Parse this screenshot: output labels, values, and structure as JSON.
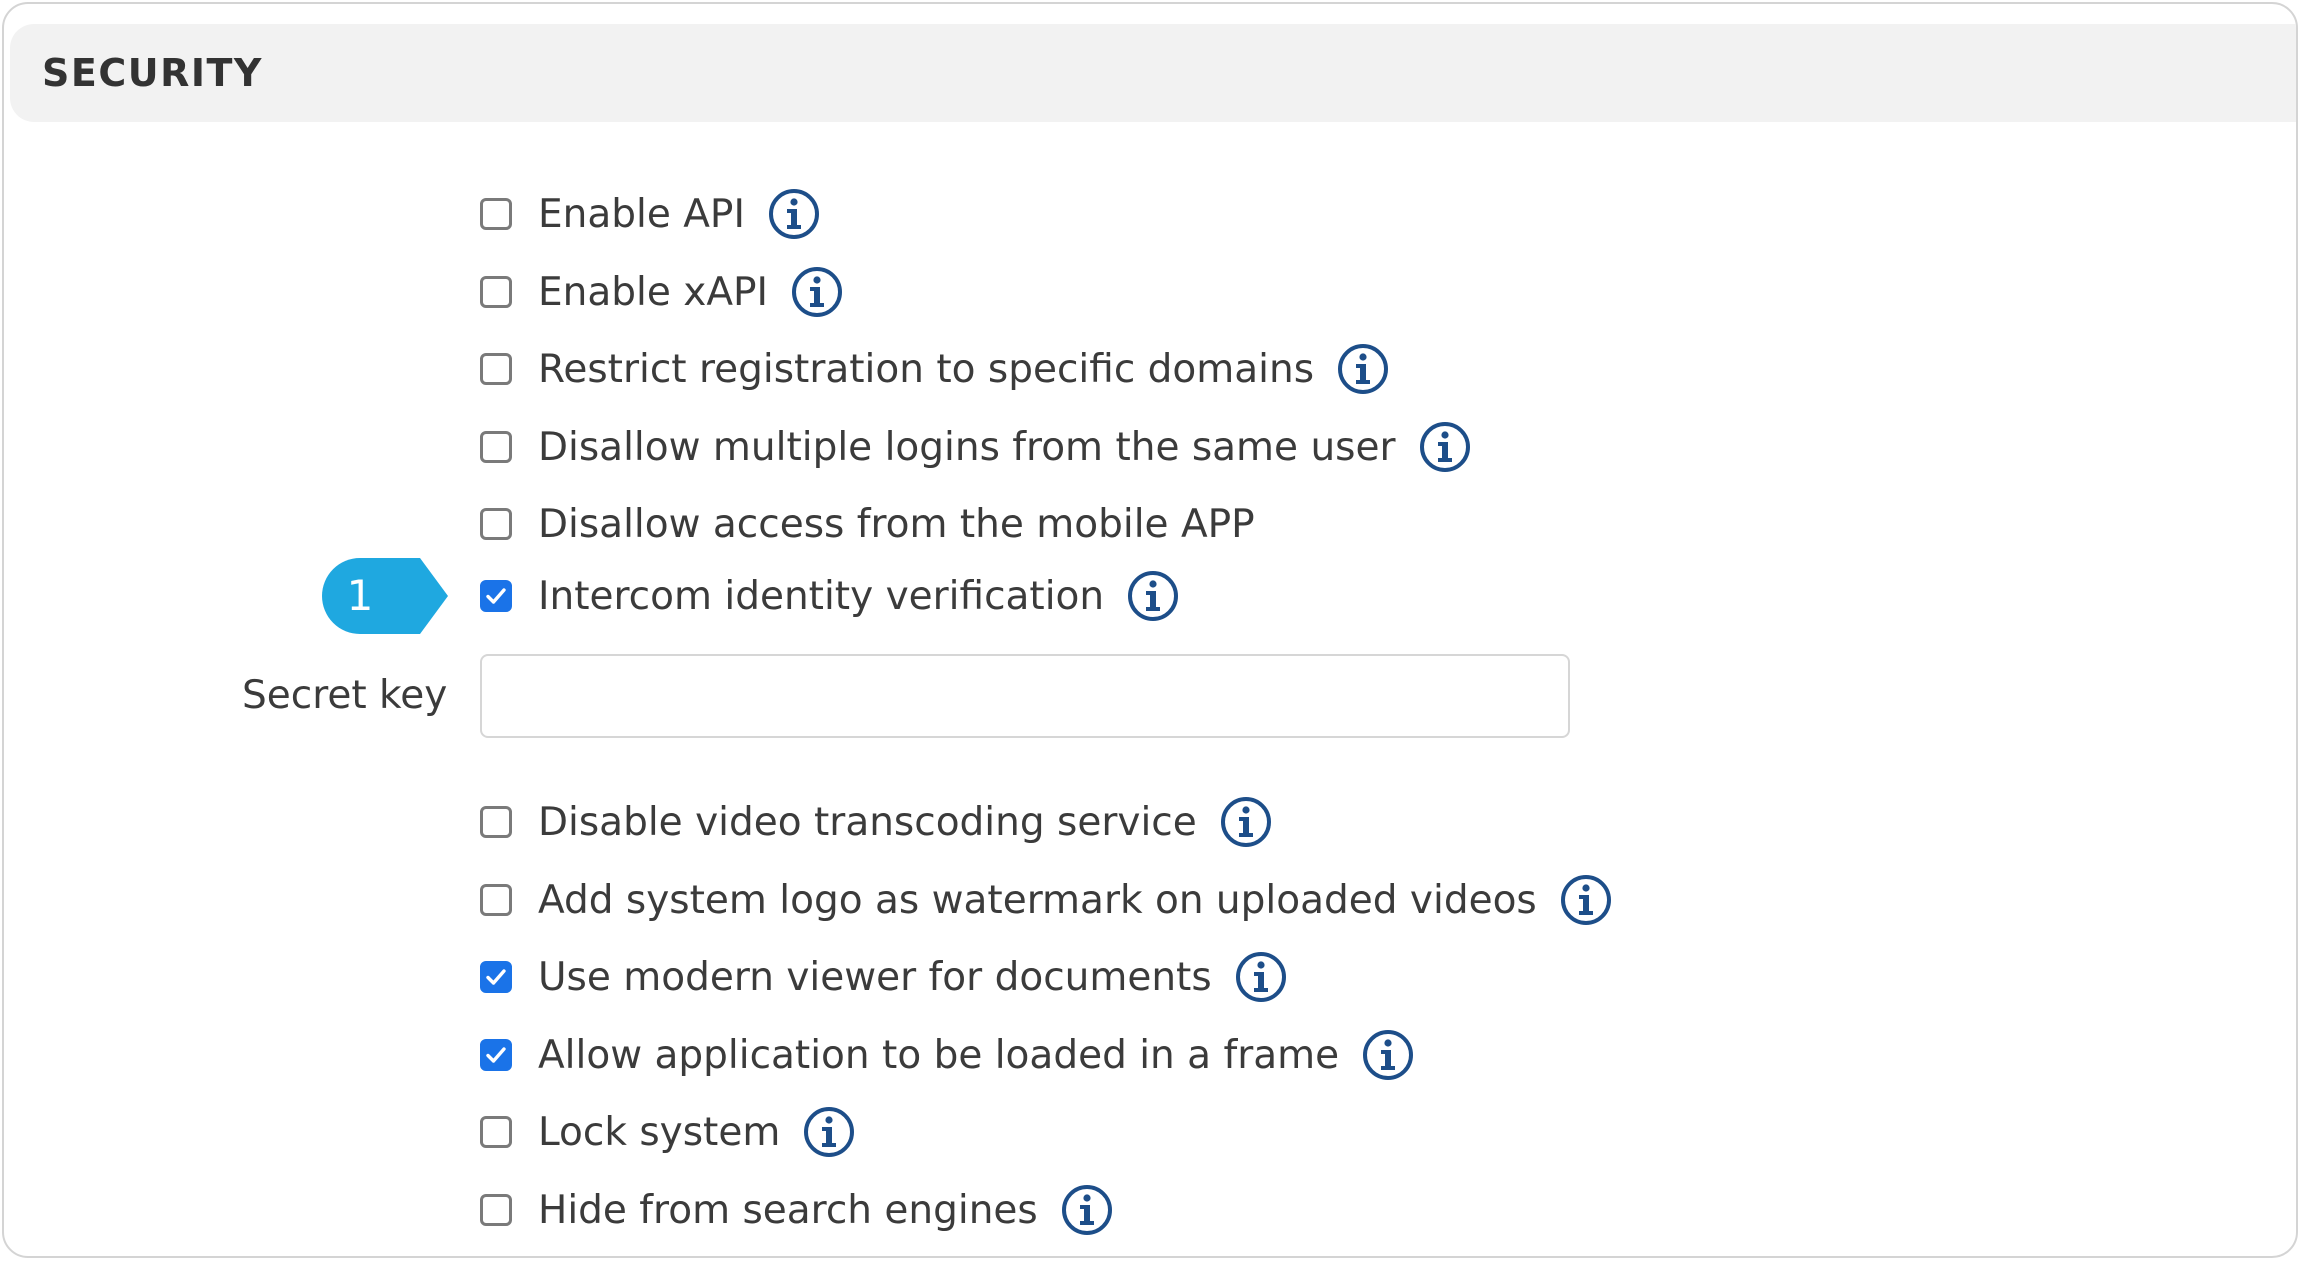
{
  "section": {
    "title": "SECURITY"
  },
  "colors": {
    "checkbox_checked": "#1a73e8",
    "info_icon": "#1d4e89",
    "callout": "#1fa8e0",
    "header_bg": "#f2f2f2"
  },
  "options": {
    "enable_api": {
      "label": "Enable API",
      "checked": false,
      "icon": "info-icon"
    },
    "enable_xapi": {
      "label": "Enable xAPI",
      "checked": false,
      "icon": "info-icon"
    },
    "restrict_registration": {
      "label": "Restrict registration to specific domains",
      "checked": false,
      "icon": "info-icon"
    },
    "disallow_multiple_logins": {
      "label": "Disallow multiple logins from the same user",
      "checked": false,
      "icon": "info-icon"
    },
    "disallow_mobile": {
      "label": "Disallow access from the mobile APP",
      "checked": false
    },
    "intercom_verification": {
      "label": "Intercom identity verification",
      "checked": true,
      "icon": "info-icon"
    },
    "disable_transcoding": {
      "label": "Disable video transcoding service",
      "checked": false,
      "icon": "info-icon"
    },
    "watermark_logo": {
      "label": "Add system logo as watermark on uploaded videos",
      "checked": false,
      "icon": "info-icon"
    },
    "modern_viewer": {
      "label": "Use modern viewer for documents",
      "checked": true,
      "icon": "info-icon"
    },
    "allow_frame": {
      "label": "Allow application to be loaded in a frame",
      "checked": true,
      "icon": "info-icon"
    },
    "lock_system": {
      "label": "Lock system",
      "checked": false,
      "icon": "info-icon"
    },
    "hide_search_engines": {
      "label": "Hide from search engines",
      "checked": false,
      "icon": "info-icon"
    }
  },
  "secret_key": {
    "label": "Secret key",
    "value": ""
  },
  "callout": {
    "number": "1"
  }
}
